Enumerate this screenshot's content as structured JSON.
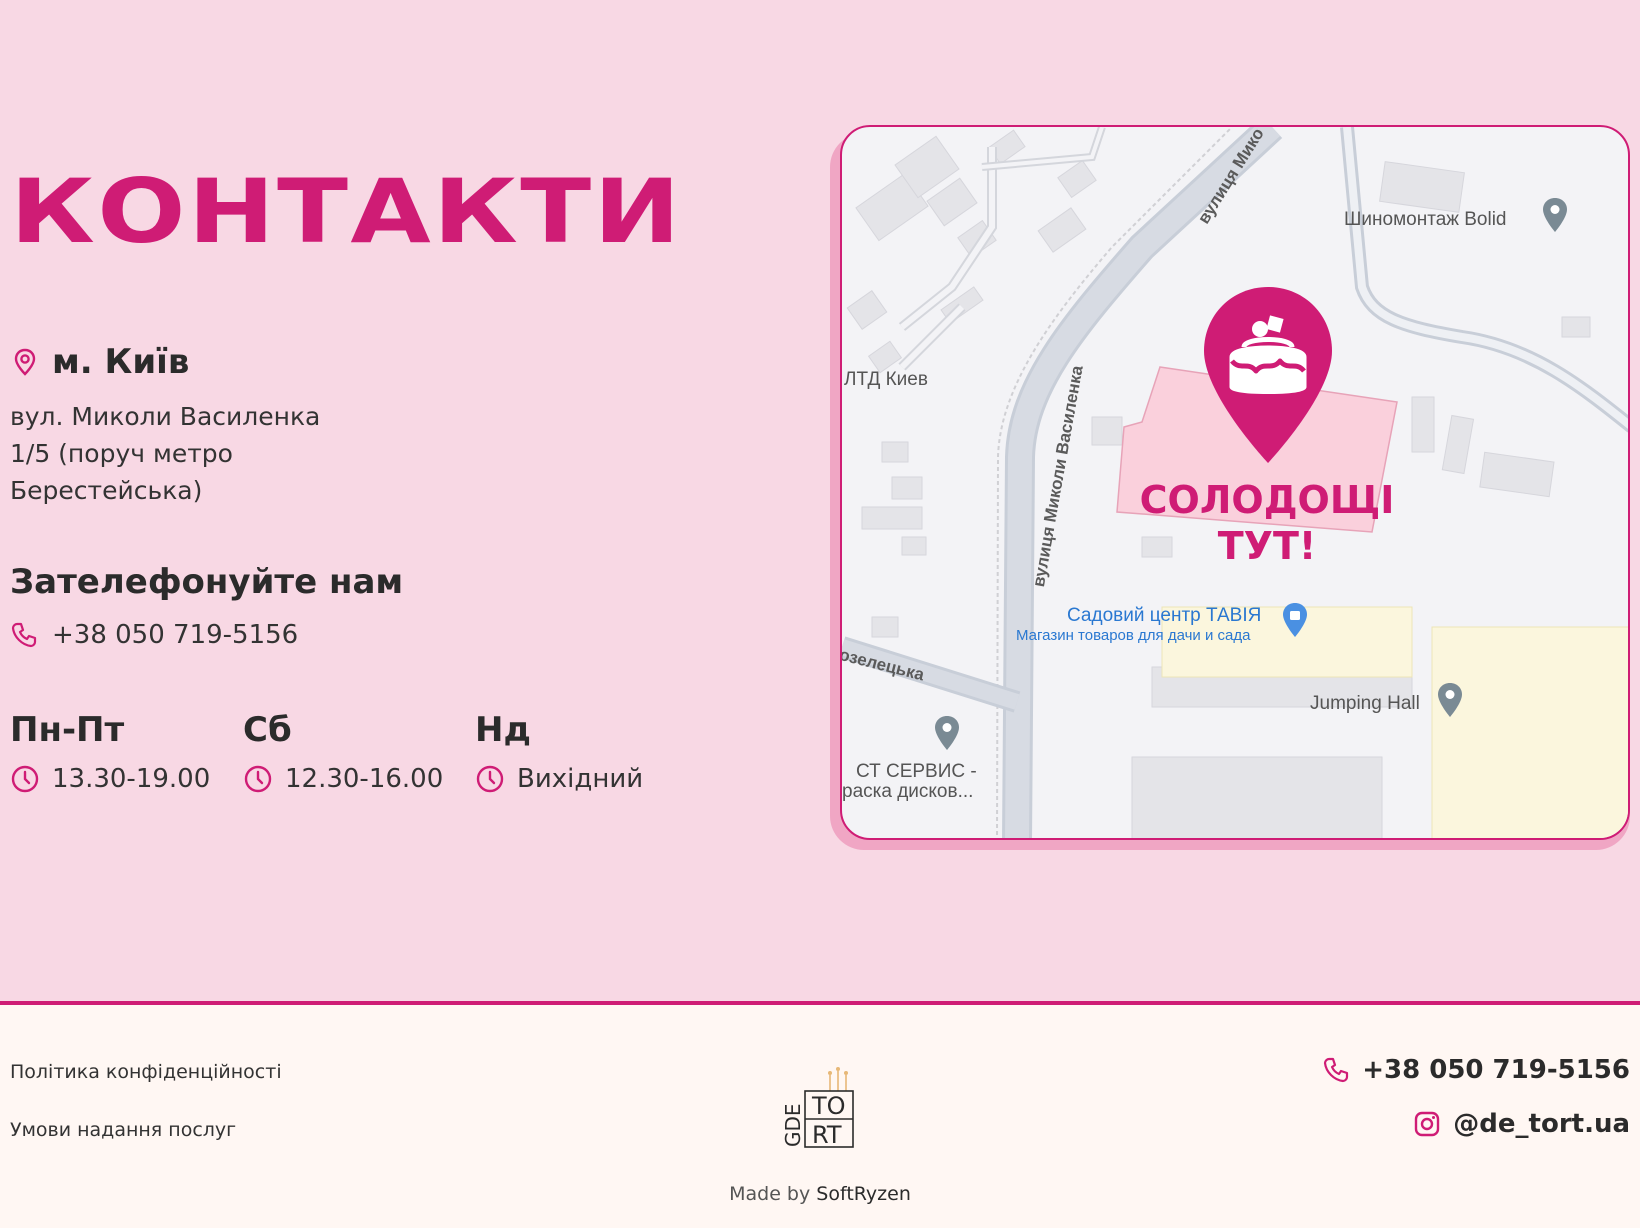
{
  "contacts": {
    "title": "КОНТАКТИ",
    "city": "м. Київ",
    "address_lines": [
      "вул. Миколи Василенка",
      "1/5 (поруч метро",
      "Берестейська)"
    ],
    "call_title": "Зателефонуйте нам",
    "phone": "+38 050 719-5156",
    "hours": [
      {
        "day": "Пн-Пт",
        "time": "13.30-19.00"
      },
      {
        "day": "Сб",
        "time": "12.30-16.00"
      },
      {
        "day": "Нд",
        "time": "Вихідний"
      }
    ]
  },
  "map": {
    "labels": {
      "tire": "Шиномонтаж Bolid",
      "ltd": "ЛТД Киев",
      "garden": "Садовий центр ТАВІЯ",
      "garden_sub": "Магазин товаров для дачи и сада",
      "jumping": "Jumping Hall",
      "service_1": "СТ СЕРВИС -",
      "service_2": "раска дисков...",
      "street_main": "вулиця Миколи Василенка",
      "street_top": "вулиця Мико",
      "street_kozel": "озелецька"
    },
    "sweet_1": "СОЛОДОЩІ",
    "sweet_2": "ТУТ!"
  },
  "footer": {
    "privacy": "Політика конфіденційності",
    "terms": "Умови надання послуг",
    "phone": "+38 050 719-5156",
    "instagram": "@de_tort.ua",
    "made_by": "Made by",
    "made_by_brand": "SoftRyzen",
    "logo_text": {
      "gde": "GDE",
      "to": "TO",
      "rt": "RT"
    }
  },
  "colors": {
    "accent": "#cf1c75",
    "page_bg": "#f8d8e4",
    "footer_bg": "#fff7f3"
  }
}
